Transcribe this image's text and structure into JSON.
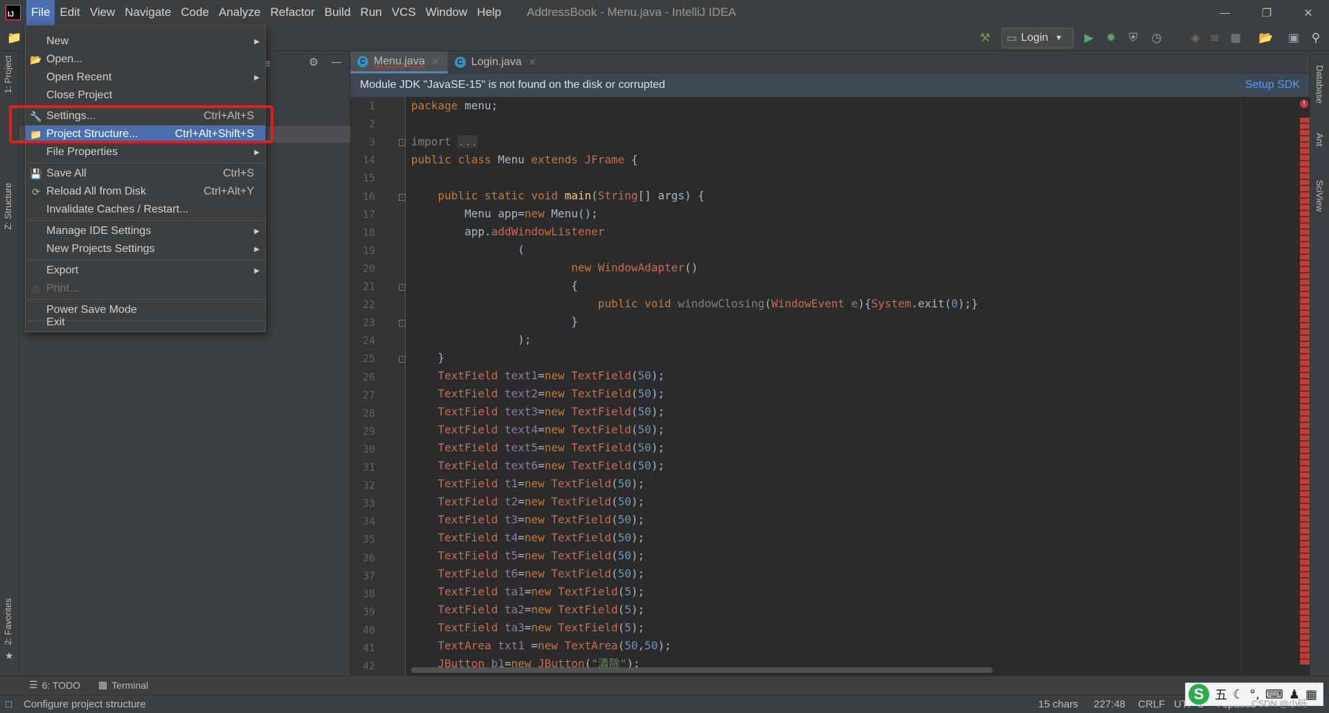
{
  "titlebar": {
    "menus": [
      "File",
      "Edit",
      "View",
      "Navigate",
      "Code",
      "Analyze",
      "Refactor",
      "Build",
      "Run",
      "VCS",
      "Window",
      "Help"
    ],
    "window_title": "AddressBook - Menu.java - IntelliJ IDEA",
    "logo_text": "IJ"
  },
  "toolbar": {
    "run_config": "Login"
  },
  "left_strip": {
    "project_tab": "1: Project",
    "structure_tab": "Z: Structure",
    "favorites_tab": "2: Favorites"
  },
  "right_strip": {
    "database_tab": "Database",
    "ant_tab": "Ant",
    "sciview_tab": "SciView"
  },
  "editor": {
    "tabs": [
      {
        "label": "Menu.java",
        "selected": true
      },
      {
        "label": "Login.java",
        "selected": false
      }
    ],
    "banner_message": "Module JDK \"JavaSE-15\" is not found on the disk or corrupted",
    "banner_action": "Setup SDK",
    "line_numbers": [
      "1",
      "2",
      "3",
      "14",
      "15",
      "16",
      "17",
      "18",
      "19",
      "20",
      "21",
      "22",
      "23",
      "24",
      "25",
      "26",
      "27",
      "28",
      "29",
      "30",
      "31",
      "32",
      "33",
      "34",
      "35",
      "36",
      "37",
      "38",
      "39",
      "40",
      "41",
      "42"
    ]
  },
  "file_menu": {
    "items": [
      {
        "label": "New",
        "shortcut": "",
        "submenu": true
      },
      {
        "label": "Open...",
        "shortcut": "",
        "submenu": false
      },
      {
        "label": "Open Recent",
        "shortcut": "",
        "submenu": true
      },
      {
        "label": "Close Project",
        "shortcut": "",
        "submenu": false
      },
      {
        "label": "Settings...",
        "shortcut": "Ctrl+Alt+S",
        "submenu": false
      },
      {
        "label": "Project Structure...",
        "shortcut": "Ctrl+Alt+Shift+S",
        "submenu": false
      },
      {
        "label": "File Properties",
        "shortcut": "",
        "submenu": true
      },
      {
        "label": "Save All",
        "shortcut": "Ctrl+S",
        "submenu": false
      },
      {
        "label": "Reload All from Disk",
        "shortcut": "Ctrl+Alt+Y",
        "submenu": false
      },
      {
        "label": "Invalidate Caches / Restart...",
        "shortcut": "",
        "submenu": false
      },
      {
        "label": "Manage IDE Settings",
        "shortcut": "",
        "submenu": true
      },
      {
        "label": "New Projects Settings",
        "shortcut": "",
        "submenu": true
      },
      {
        "label": "Export",
        "shortcut": "",
        "submenu": true
      },
      {
        "label": "Print...",
        "shortcut": "",
        "submenu": false
      },
      {
        "label": "Power Save Mode",
        "shortcut": "",
        "submenu": false
      },
      {
        "label": "Exit",
        "shortcut": "",
        "submenu": false
      }
    ]
  },
  "bottom_bar": {
    "todo": "6: TODO",
    "terminal": "Terminal"
  },
  "status_bar": {
    "message": "Configure project structure",
    "chars": "15 chars",
    "position": "227:48",
    "line_sep": "CRLF",
    "encoding": "UTF-8",
    "indent": "4 spaces"
  },
  "ime": {
    "logo": "S",
    "mode": "五"
  },
  "watermark": "CSDN @小码",
  "colors": {
    "accent": "#4b6eaf",
    "highlight_box": "#e0201c",
    "banner": "#3b4754",
    "link": "#589df6"
  }
}
